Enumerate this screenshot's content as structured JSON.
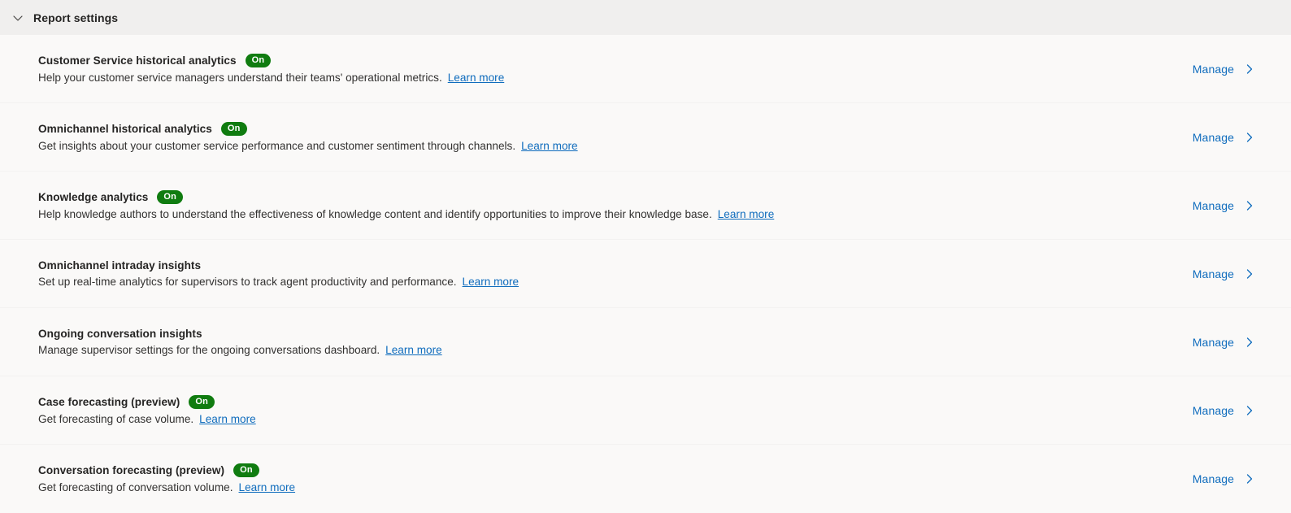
{
  "header": {
    "title": "Report settings",
    "collapse_icon": "chevron-down-icon",
    "expanded": true
  },
  "common": {
    "manage_label": "Manage",
    "manage_icon": "chevron-right-icon",
    "learn_more_label": "Learn more",
    "badge_on_label": "On"
  },
  "colors": {
    "badge_on": "#107c10",
    "link": "#0f6cbd",
    "header_band": "#f0efee",
    "content_background": "#faf9f8",
    "divider": "#f3f2f1",
    "title_text": "#252423",
    "body_text": "#323130"
  },
  "rows": [
    {
      "title": "Customer Service historical analytics",
      "badge": "On",
      "description": "Help your customer service managers understand their teams' operational metrics.",
      "learn_more": "Learn more",
      "action": "Manage"
    },
    {
      "title": "Omnichannel historical analytics",
      "badge": "On",
      "description": "Get insights about your customer service performance and customer sentiment through channels.",
      "learn_more": "Learn more",
      "action": "Manage"
    },
    {
      "title": "Knowledge analytics",
      "badge": "On",
      "description": "Help knowledge authors to understand the effectiveness of knowledge content and identify opportunities to improve their knowledge base.",
      "learn_more": "Learn more",
      "action": "Manage"
    },
    {
      "title": "Omnichannel intraday insights",
      "badge": "",
      "description": "Set up real-time analytics for supervisors to track agent productivity and performance.",
      "learn_more": "Learn more",
      "action": "Manage"
    },
    {
      "title": "Ongoing conversation insights",
      "badge": "",
      "description": "Manage supervisor settings for the ongoing conversations dashboard.",
      "learn_more": "Learn more",
      "action": "Manage"
    },
    {
      "title": "Case forecasting (preview)",
      "badge": "On",
      "description": "Get forecasting of case volume.",
      "learn_more": "Learn more",
      "action": "Manage"
    },
    {
      "title": "Conversation forecasting (preview)",
      "badge": "On",
      "description": "Get forecasting of conversation volume.",
      "learn_more": "Learn more",
      "action": "Manage"
    }
  ]
}
